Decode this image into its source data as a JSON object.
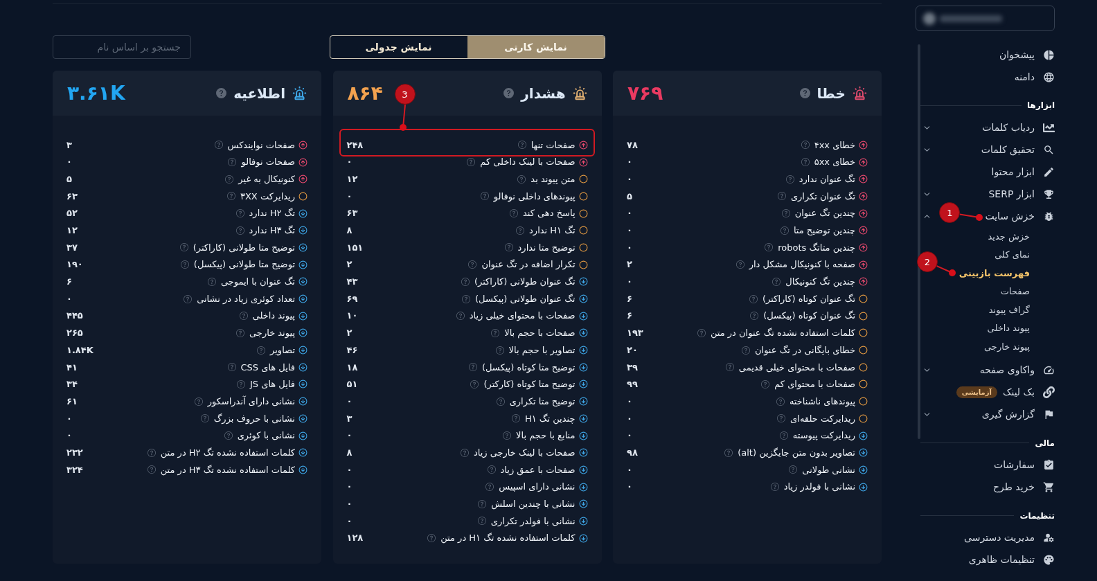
{
  "sidebar": {
    "groups": [
      {
        "items": [
          {
            "label": "پیشخوان",
            "selected": false
          },
          {
            "label": "دامنه",
            "selected": false
          }
        ]
      },
      {
        "title": "ابزارها",
        "items": [
          {
            "label": "ردیاب کلمات",
            "selected": false,
            "expanded": false
          },
          {
            "label": "تحقیق کلمات",
            "selected": false,
            "expanded": false
          },
          {
            "label": "ابزار محتوا",
            "selected": false
          },
          {
            "label": "ابزار SERP",
            "selected": false,
            "expanded": false
          },
          {
            "label": "خزش سایت",
            "selected": false,
            "expanded": true,
            "annotation": "1",
            "children": [
              {
                "label": "خزش جدید",
                "selected": false
              },
              {
                "label": "نمای کلی",
                "selected": false
              },
              {
                "label": "فهرست بازبینی",
                "selected": true,
                "annotation": "2"
              },
              {
                "label": "صفحات",
                "selected": false
              },
              {
                "label": "گراف پیوند",
                "selected": false
              },
              {
                "label": "پیوند داخلی",
                "selected": false
              },
              {
                "label": "پیوند خارجی",
                "selected": false
              }
            ]
          },
          {
            "label": "واکاوی صفحه",
            "selected": false,
            "expanded": false
          },
          {
            "label": "بک لینک",
            "selected": false,
            "badge": "آزمایشی"
          },
          {
            "label": "گزارش گیری",
            "selected": false,
            "expanded": false
          }
        ]
      },
      {
        "title": "مالی",
        "items": [
          {
            "label": "سفارشات",
            "selected": false
          },
          {
            "label": "خرید طرح",
            "selected": false
          }
        ]
      },
      {
        "title": "تنظیمات",
        "items": [
          {
            "label": "مدیریت دسترسی",
            "selected": false
          },
          {
            "label": "تنظیمات ظاهری",
            "selected": false
          }
        ]
      }
    ]
  },
  "main": {
    "view_toggle": [
      {
        "label": "نمایش کارتی",
        "selected": true
      },
      {
        "label": "نمایش جدولی",
        "selected": false
      }
    ],
    "search": {
      "placeholder": "جستجو بر اساس نام"
    },
    "cards": [
      {
        "kind": "error",
        "title": "خطا",
        "total": "۷۶۹",
        "rows": [
          {
            "kind": "high",
            "label": "خطای ۴xx",
            "value": "۷۸"
          },
          {
            "kind": "high",
            "label": "خطای ۵xx",
            "value": "۰"
          },
          {
            "kind": "high",
            "label": "تگ عنوان ندارد",
            "value": "۰"
          },
          {
            "kind": "high",
            "label": "تگ عنوان تکراری",
            "value": "۵"
          },
          {
            "kind": "high",
            "label": "چندین تگ عنوان",
            "value": "۰"
          },
          {
            "kind": "high",
            "label": "چندین توضیح متا",
            "value": "۰"
          },
          {
            "kind": "high",
            "label": "چندین متاتگ robots",
            "value": "۰"
          },
          {
            "kind": "high",
            "label": "صفحه با کنونیکال مشکل دار",
            "value": "۲"
          },
          {
            "kind": "high",
            "label": "چندین تگ کنونیکال",
            "value": "۰"
          },
          {
            "kind": "medium",
            "label": "تگ عنوان کوتاه (کاراکتر)",
            "value": "۶"
          },
          {
            "kind": "medium",
            "label": "تگ عنوان کوتاه (پیکسل)",
            "value": "۶"
          },
          {
            "kind": "medium",
            "label": "کلمات استفاده نشده تگ عنوان در متن",
            "value": "۱۹۳"
          },
          {
            "kind": "medium",
            "label": "خطای بایگانی در تگ عنوان",
            "value": "۲۰"
          },
          {
            "kind": "medium",
            "label": "صفحات با محتوای خیلی قدیمی",
            "value": "۳۹"
          },
          {
            "kind": "medium",
            "label": "صفحات با محتوای کم",
            "value": "۹۹"
          },
          {
            "kind": "medium",
            "label": "پیوندهای ناشناخته",
            "value": "۰"
          },
          {
            "kind": "medium",
            "label": "ریدایرکت حلقه‌ای",
            "value": "۰"
          },
          {
            "kind": "low",
            "label": "ریدایرکت پیوسته",
            "value": "۰"
          },
          {
            "kind": "low",
            "label": "تصاویر بدون متن جایگزین (alt)",
            "value": "۹۸"
          },
          {
            "kind": "low",
            "label": "نشانی طولانی",
            "value": "۰"
          },
          {
            "kind": "low",
            "label": "نشانی با فولدر زیاد",
            "value": "۰"
          }
        ]
      },
      {
        "kind": "warning",
        "title": "هشدار",
        "total": "۸۶۴",
        "rows": [
          {
            "kind": "high",
            "label": "صفحات تنها",
            "value": "۲۴۸",
            "annotation": "3"
          },
          {
            "kind": "high",
            "label": "صفحات با لینک داخلی کم",
            "value": "۰"
          },
          {
            "kind": "medium",
            "label": "متن پیوند بد",
            "value": "۱۲"
          },
          {
            "kind": "medium",
            "label": "پیوندهای داخلی نوفالو",
            "value": "۰"
          },
          {
            "kind": "medium",
            "label": "پاسخ دهی کند",
            "value": "۶۳"
          },
          {
            "kind": "medium",
            "label": "تگ H۱ ندارد",
            "value": "۸"
          },
          {
            "kind": "medium",
            "label": "توضیح متا ندارد",
            "value": "۱۵۱"
          },
          {
            "kind": "medium",
            "label": "تکرار اضافه در تگ عنوان",
            "value": "۲"
          },
          {
            "kind": "low",
            "label": "تگ عنوان طولانی (کاراکتر)",
            "value": "۴۳"
          },
          {
            "kind": "low",
            "label": "تگ عنوان طولانی (پیکسل)",
            "value": "۶۹"
          },
          {
            "kind": "low",
            "label": "صفحات با محتوای خیلی زیاد",
            "value": "۱۰"
          },
          {
            "kind": "low",
            "label": "صفحات با حجم بالا",
            "value": "۲"
          },
          {
            "kind": "low",
            "label": "تصاویر با حجم بالا",
            "value": "۴۶"
          },
          {
            "kind": "low",
            "label": "توضیح متا کوتاه (پیکسل)",
            "value": "۱۸"
          },
          {
            "kind": "low",
            "label": "توضیح متا کوتاه (کارکتر)",
            "value": "۵۱"
          },
          {
            "kind": "low",
            "label": "توضیح متا تکراری",
            "value": "۰"
          },
          {
            "kind": "low",
            "label": "چندین تگ H۱",
            "value": "۳"
          },
          {
            "kind": "low",
            "label": "منابع با حجم بالا",
            "value": "۰"
          },
          {
            "kind": "low",
            "label": "صفحات با لینک خارجی زیاد",
            "value": "۸"
          },
          {
            "kind": "low",
            "label": "صفحات با عمق زیاد",
            "value": "۰"
          },
          {
            "kind": "low",
            "label": "نشانی دارای اسپیس",
            "value": "۰"
          },
          {
            "kind": "low",
            "label": "نشانی با چندین اسلش",
            "value": "۰"
          },
          {
            "kind": "low",
            "label": "نشانی با فولدر تکراری",
            "value": "۰"
          },
          {
            "kind": "low",
            "label": "کلمات استفاده نشده تگ H۱ در متن",
            "value": "۱۲۸"
          }
        ]
      },
      {
        "kind": "info",
        "title": "اطلاعیه",
        "total": "۳.۶۱K",
        "rows": [
          {
            "kind": "high",
            "label": "صفحات نوایندکس",
            "value": "۳"
          },
          {
            "kind": "high",
            "label": "صفحات نوفالو",
            "value": "۰"
          },
          {
            "kind": "high",
            "label": "کنونیکال به غیر",
            "value": "۵"
          },
          {
            "kind": "medium",
            "label": "ریدایرکت ۳XX",
            "value": "۶۳"
          },
          {
            "kind": "low",
            "label": "تگ H۲ ندارد",
            "value": "۵۲"
          },
          {
            "kind": "low",
            "label": "تگ H۳ ندارد",
            "value": "۱۲"
          },
          {
            "kind": "low",
            "label": "توضیح متا طولانی (کاراکتر)",
            "value": "۳۷"
          },
          {
            "kind": "low",
            "label": "توضیح متا طولانی (پیکسل)",
            "value": "۱۹۰"
          },
          {
            "kind": "low",
            "label": "تگ عنوان با ایموجی",
            "value": "۶"
          },
          {
            "kind": "low",
            "label": "تعداد کوئری زیاد در نشانی",
            "value": "۰"
          },
          {
            "kind": "low",
            "label": "پیوند داخلی",
            "value": "۴۴۵"
          },
          {
            "kind": "low",
            "label": "پیوند خارجی",
            "value": "۲۶۵"
          },
          {
            "kind": "low",
            "label": "تصاویر",
            "value": "۱.۸۴K"
          },
          {
            "kind": "low",
            "label": "فایل های CSS",
            "value": "۴۱"
          },
          {
            "kind": "low",
            "label": "فایل های JS",
            "value": "۳۴"
          },
          {
            "kind": "low",
            "label": "نشانی دارای آندراسکور",
            "value": "۶۱"
          },
          {
            "kind": "low",
            "label": "نشانی با حروف بزرگ",
            "value": "۰"
          },
          {
            "kind": "low",
            "label": "نشانی با کوئری",
            "value": "۰"
          },
          {
            "kind": "low",
            "label": "کلمات استفاده نشده تگ H۲ در متن",
            "value": "۲۳۲"
          },
          {
            "kind": "low",
            "label": "کلمات استفاده نشده تگ H۳ در متن",
            "value": "۳۲۴"
          }
        ]
      }
    ]
  }
}
